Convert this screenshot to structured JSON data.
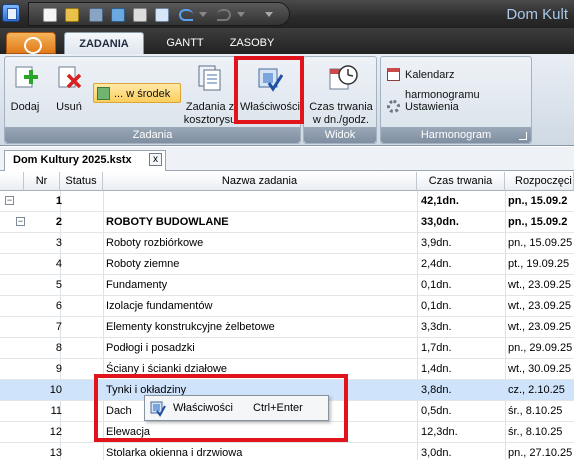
{
  "window": {
    "title": "Dom Kult"
  },
  "quick_access": [
    "new-icon",
    "open-icon",
    "save-icon",
    "save-check-icon",
    "print-icon",
    "copy-icon",
    "undo-icon",
    "redo-icon",
    "customize-icon"
  ],
  "tabs": {
    "zadania": "ZADANIA",
    "gantt": "GANTT",
    "zasoby": "ZASOBY"
  },
  "ribbon": {
    "zadania_group": {
      "label": "Zadania",
      "dodaj": "Dodaj",
      "usun": "Usuń",
      "w_srodek": "... w środek",
      "zadania_z_line1": "Zadania z",
      "zadania_z_line2": "kosztorysu",
      "wlasciwosci": "Właściwości"
    },
    "widok_group": {
      "label": "Widok",
      "czas_line1": "Czas trwania",
      "czas_line2": "w dn./godz."
    },
    "harmonogram_group": {
      "label": "Harmonogram",
      "kalendarz": "Kalendarz harmonogramu",
      "ustawienia": "Ustawienia"
    }
  },
  "document": {
    "tab_title": "Dom Kultury 2025.kstx",
    "close": "x"
  },
  "grid": {
    "headers": {
      "nr": "Nr",
      "status": "Status",
      "name": "Nazwa zadania",
      "duration": "Czas trwania",
      "start": "Rozpoczęci"
    },
    "rows": [
      {
        "nr": "1",
        "name": "",
        "duration": "42,1dn.",
        "start": "pn., 15.09.2",
        "bold": true,
        "level": 0,
        "expander": "−"
      },
      {
        "nr": "2",
        "name": "ROBOTY BUDOWLANE",
        "duration": "33,0dn.",
        "start": "pn., 15.09.2",
        "bold": true,
        "level": 1,
        "expander": "−"
      },
      {
        "nr": "3",
        "name": "Roboty rozbiórkowe",
        "duration": "3,9dn.",
        "start": "pn., 15.09.25"
      },
      {
        "nr": "4",
        "name": "Roboty ziemne",
        "duration": "2,4dn.",
        "start": "pt., 19.09.25"
      },
      {
        "nr": "5",
        "name": "Fundamenty",
        "duration": "0,1dn.",
        "start": "wt., 23.09.25"
      },
      {
        "nr": "6",
        "name": "Izolacje fundamentów",
        "duration": "0,1dn.",
        "start": "wt., 23.09.25"
      },
      {
        "nr": "7",
        "name": "Elementy konstrukcyjne żelbetowe",
        "duration": "3,3dn.",
        "start": "wt., 23.09.25"
      },
      {
        "nr": "8",
        "name": "Podłogi i posadzki",
        "duration": "1,7dn.",
        "start": "pn., 29.09.25"
      },
      {
        "nr": "9",
        "name": "Ściany i ścianki działowe",
        "duration": "1,4dn.",
        "start": "wt., 30.09.25"
      },
      {
        "nr": "10",
        "name": "Tynki i okładziny",
        "duration": "3,8dn.",
        "start": "cz., 2.10.25",
        "selected": true
      },
      {
        "nr": "11",
        "name": "Dach",
        "duration": "0,5dn.",
        "start": "śr., 8.10.25"
      },
      {
        "nr": "12",
        "name": "Elewacja",
        "duration": "12,3dn.",
        "start": "śr., 8.10.25"
      },
      {
        "nr": "13",
        "name": "Stolarka okienna i drzwiowa",
        "duration": "3,0dn.",
        "start": "pn., 27.10.25"
      }
    ]
  },
  "context_menu": {
    "item_label": "Właściwości",
    "shortcut": "Ctrl+Enter"
  }
}
